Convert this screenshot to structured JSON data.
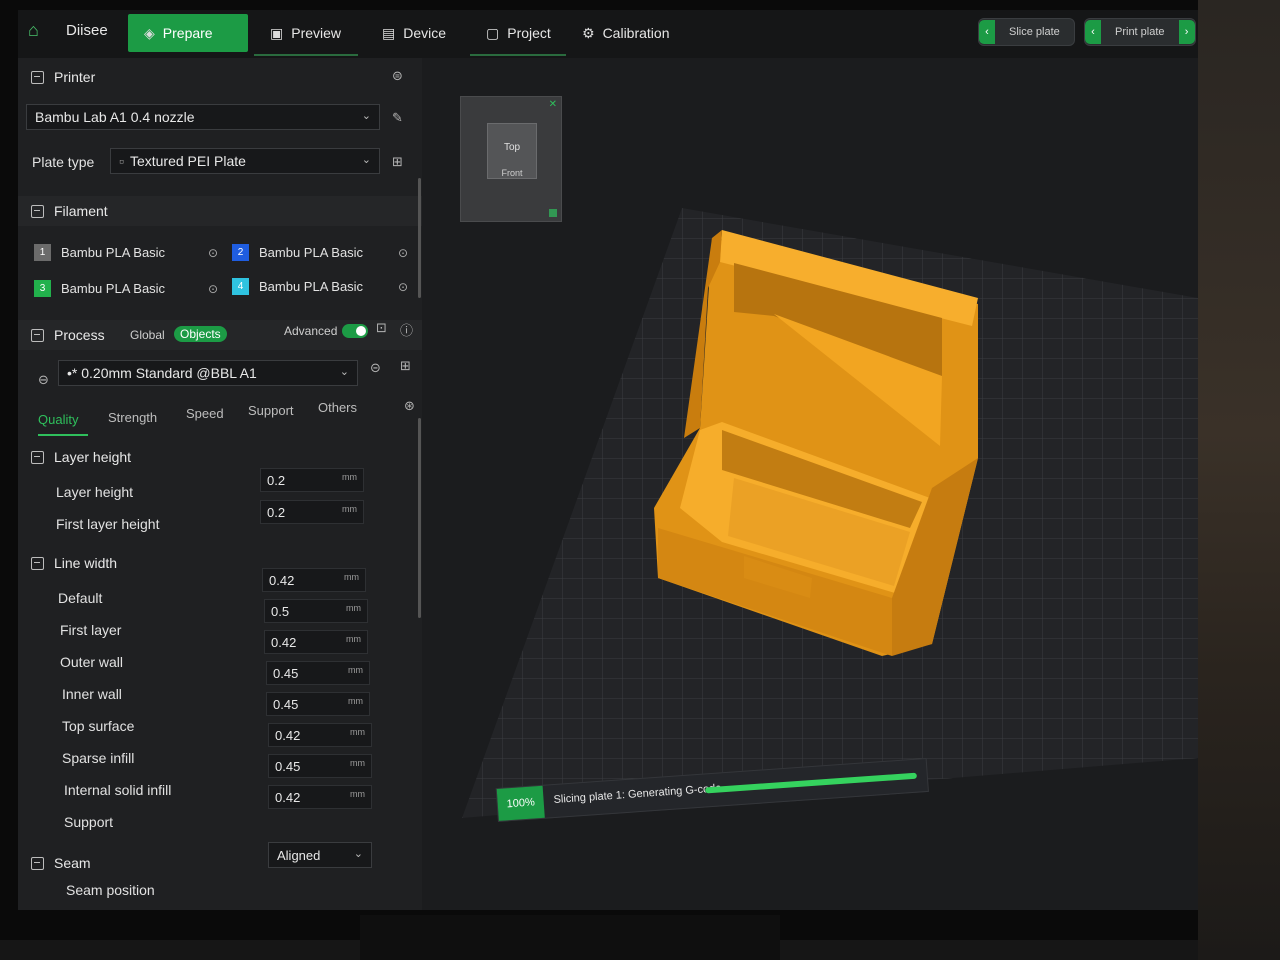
{
  "app": {
    "name": "Diisee"
  },
  "tabs": [
    {
      "label": "Prepare",
      "icon": "prepare-icon"
    },
    {
      "label": "Preview",
      "icon": "preview-icon"
    },
    {
      "label": "Device",
      "icon": "device-icon"
    },
    {
      "label": "Project",
      "icon": "project-icon"
    },
    {
      "label": "Calibration",
      "icon": "calibration-icon"
    }
  ],
  "top_buttons": {
    "slice": "Slice plate",
    "print": "Print plate"
  },
  "printer": {
    "header": "Printer",
    "model": "Bambu Lab A1 0.4 nozzle",
    "plate_label": "Plate type",
    "plate_value": "Textured PEI Plate"
  },
  "filament": {
    "header": "Filament",
    "items": [
      {
        "num": "1",
        "name": "Bambu PLA Basic",
        "color": "#6b6b6b"
      },
      {
        "num": "2",
        "name": "Bambu PLA Basic",
        "color": "#1f5de0"
      },
      {
        "num": "3",
        "name": "Bambu PLA Basic",
        "color": "#22b14c"
      },
      {
        "num": "4",
        "name": "Bambu PLA Basic",
        "color": "#2fc3e0"
      }
    ]
  },
  "process": {
    "header": "Process",
    "global": "Global",
    "objects": "Objects",
    "advanced": "Advanced",
    "preset": "•* 0.20mm Standard @BBL A1"
  },
  "process_tabs": [
    "Quality",
    "Strength",
    "Speed",
    "Support",
    "Others"
  ],
  "quality": {
    "layer_height_group": "Layer height",
    "layer_height_label": "Layer height",
    "layer_height_value": "0.2",
    "first_layer_height_label": "First layer height",
    "first_layer_height_value": "0.2",
    "unit": "mm",
    "line_width_group": "Line width",
    "line_width": [
      {
        "label": "Default",
        "value": "0.42"
      },
      {
        "label": "First layer",
        "value": "0.5"
      },
      {
        "label": "Outer wall",
        "value": "0.42"
      },
      {
        "label": "Inner wall",
        "value": "0.45"
      },
      {
        "label": "Top surface",
        "value": "0.45"
      },
      {
        "label": "Sparse infill",
        "value": "0.42"
      },
      {
        "label": "Internal solid infill",
        "value": "0.45"
      },
      {
        "label": "Support",
        "value": "0.42"
      }
    ],
    "seam_group": "Seam",
    "seam_position_label": "Seam position",
    "seam_position_value": "Aligned"
  },
  "navcube": {
    "top": "Top",
    "front": "Front"
  },
  "slicing": {
    "percent": "100%",
    "message": "Slicing plate 1: Generating G-code",
    "progress": 1.0
  },
  "colors": {
    "accent": "#1c9b45",
    "model": "#f0a21a"
  }
}
